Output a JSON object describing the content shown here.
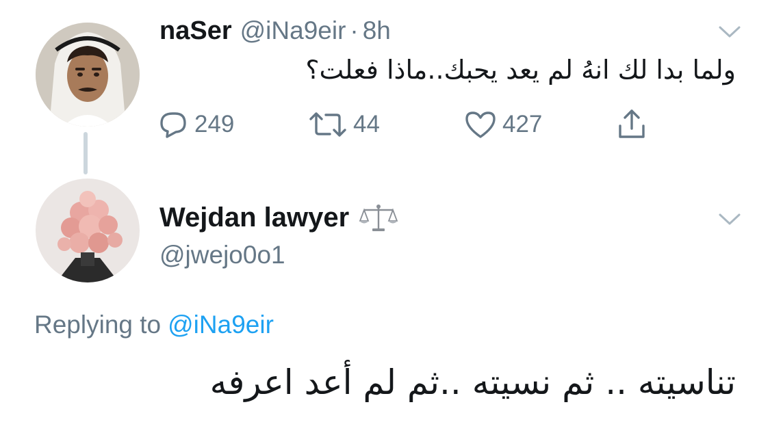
{
  "parent_tweet": {
    "display_name": "naSer",
    "handle": "@iNa9eir",
    "separator": "·",
    "time": "8h",
    "text": "ولما بدا لك انهُ لم يعد يحبك..ماذا فعلت؟",
    "actions": {
      "reply_count": "249",
      "retweet_count": "44",
      "like_count": "427"
    },
    "icons": {
      "reply": "speech-bubble-icon",
      "retweet": "retweet-icon",
      "like": "heart-icon",
      "share": "share-icon",
      "menu": "chevron-down-icon"
    }
  },
  "reply_tweet": {
    "display_name": "Wejdan lawyer",
    "name_emoji": "balance-scale-icon",
    "handle": "@jwejo0o1",
    "replying_prefix": "Replying to",
    "replying_to": "@iNa9eir",
    "text": "تناسيته .. ثم نسيته ..ثم لم أعد اعرفه",
    "icons": {
      "menu": "chevron-down-icon"
    }
  },
  "colors": {
    "text": "#14171a",
    "secondary": "#657786",
    "link": "#1da1f2",
    "thread_line": "#ccd6dd"
  }
}
